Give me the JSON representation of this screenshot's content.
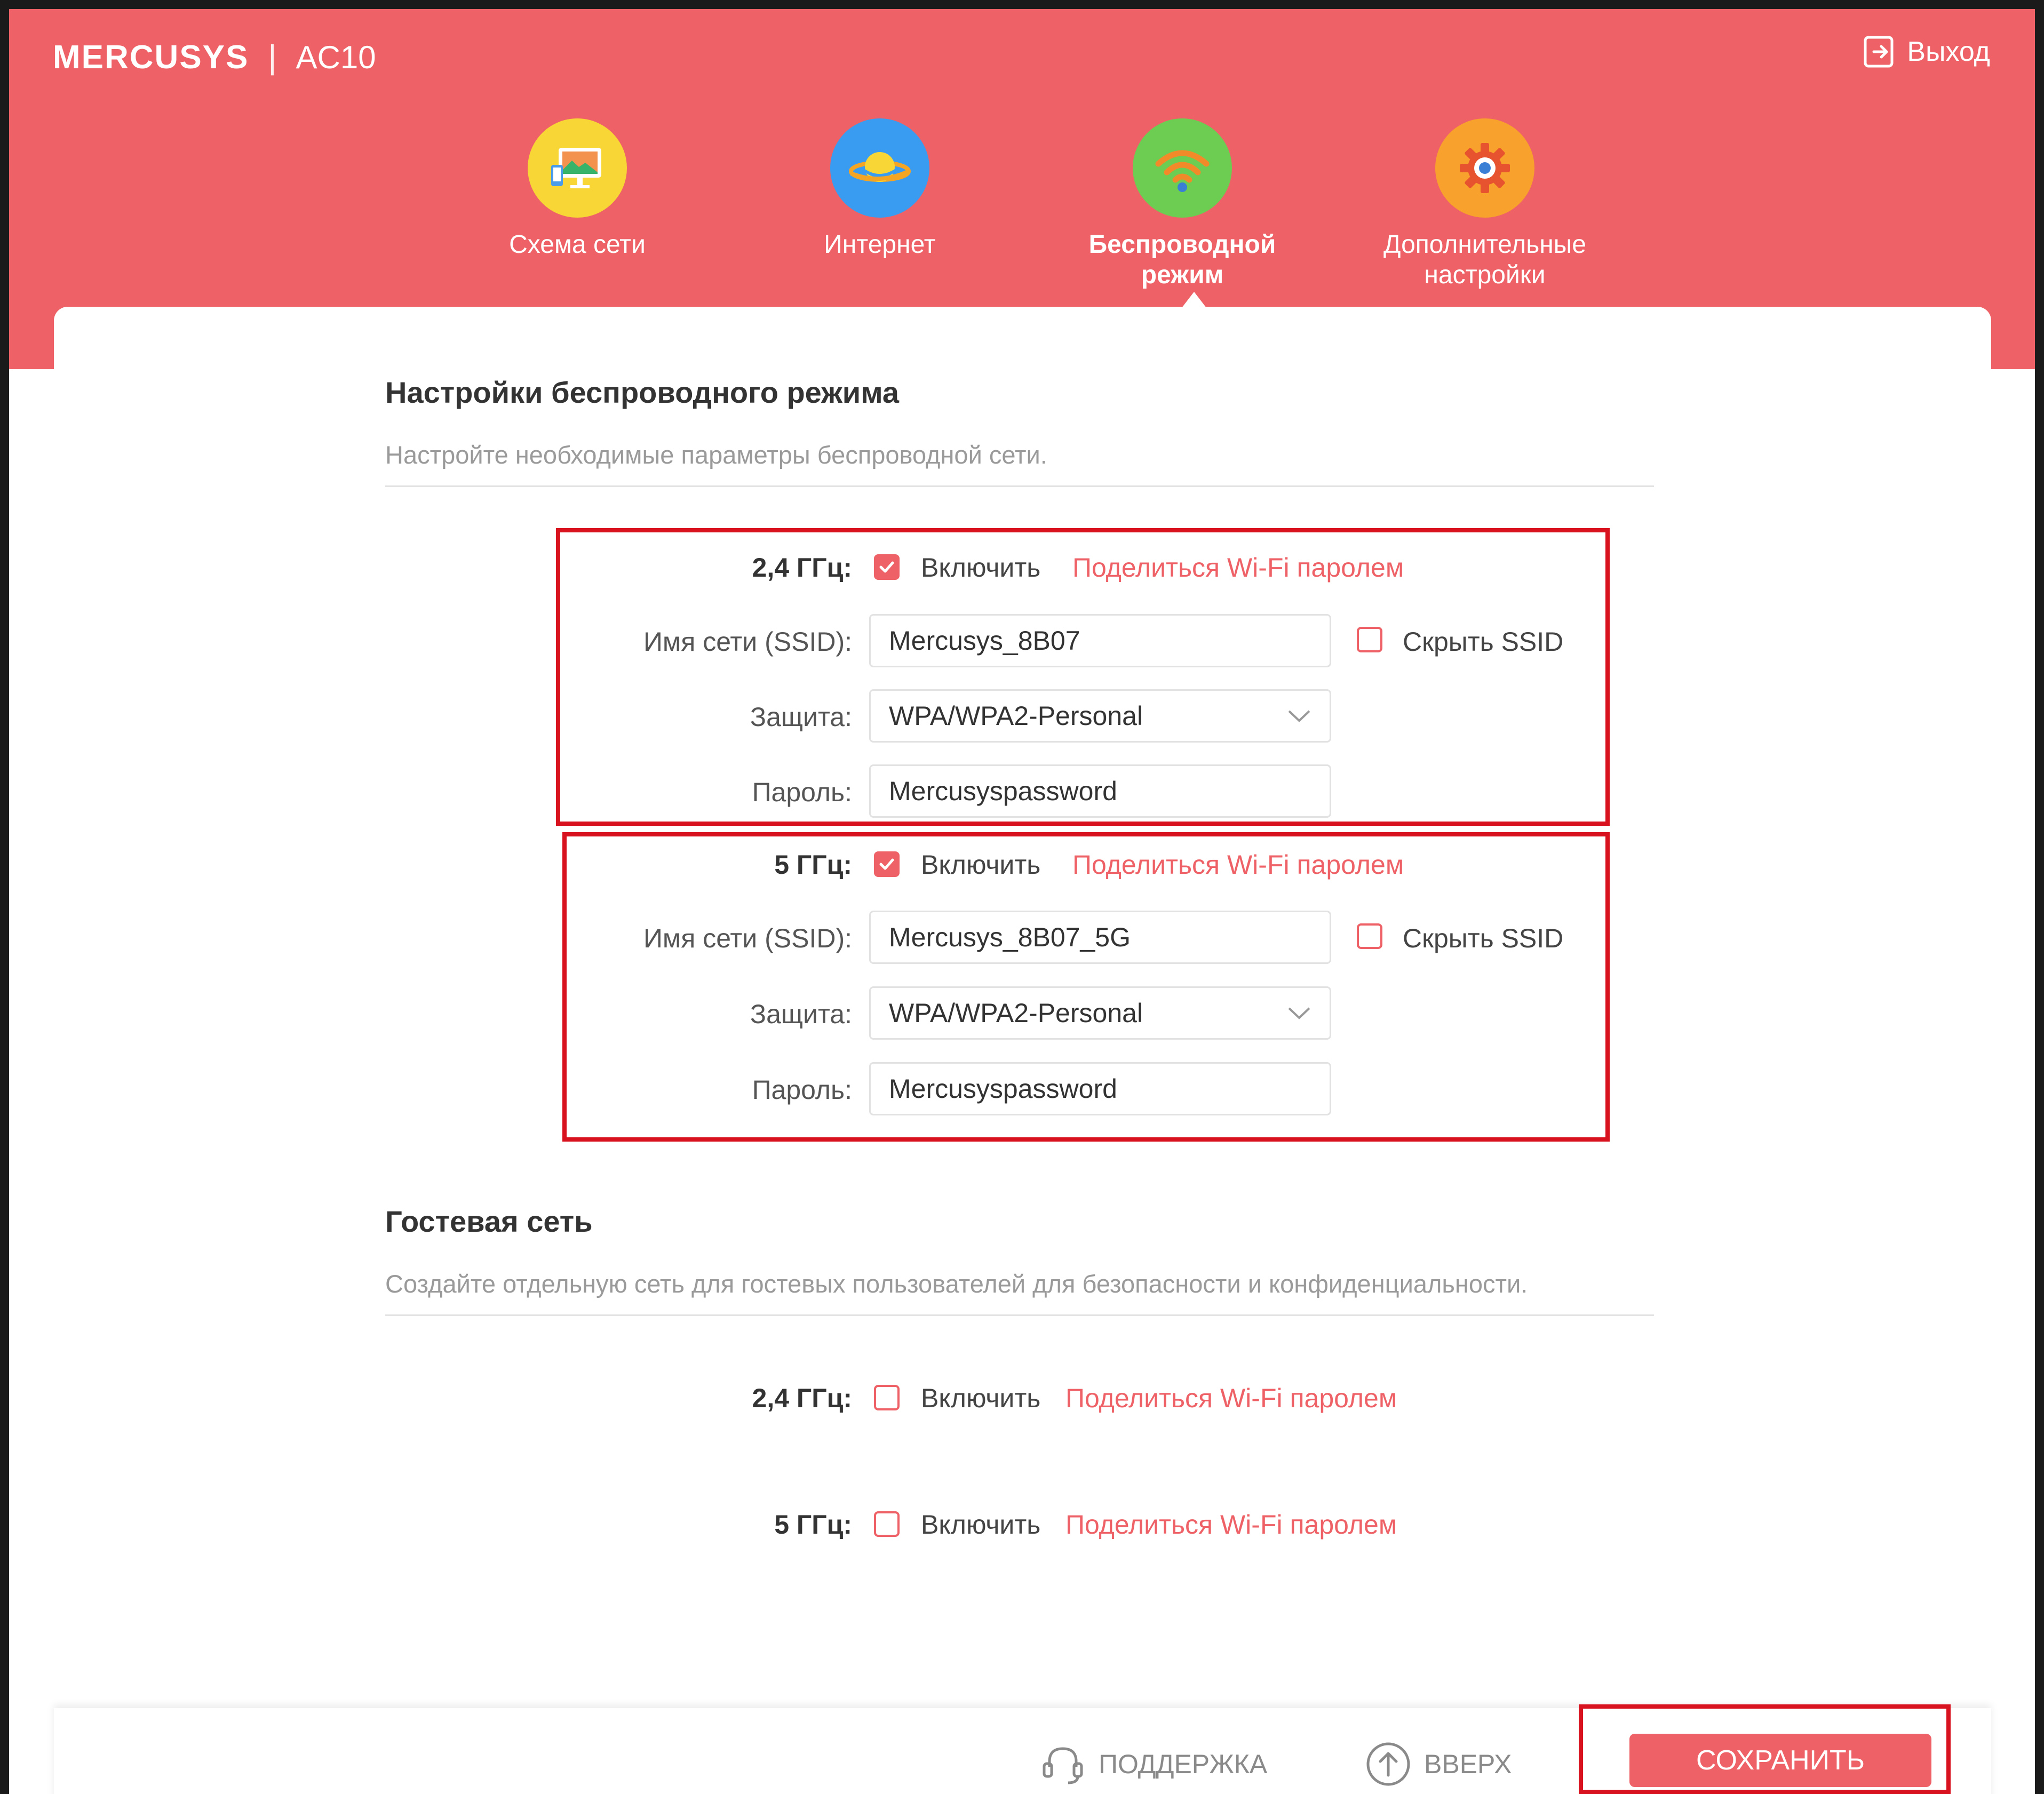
{
  "header": {
    "brand": "MERCUSYS",
    "model": "AC10",
    "logout_label": "Выход",
    "accent_color": "#ee6166"
  },
  "nav": [
    {
      "label": "Схема сети",
      "icon": "network-map-icon",
      "active": false
    },
    {
      "label": "Интернет",
      "icon": "internet-planet-icon",
      "active": false
    },
    {
      "label": "Беспроводной режим",
      "icon": "wifi-icon",
      "active": true
    },
    {
      "label": "Дополнительные настройки",
      "icon": "gear-icon",
      "active": false
    }
  ],
  "wireless": {
    "title": "Настройки беспроводного режима",
    "subtitle": "Настройте необходимые параметры беспроводной сети.",
    "band24": {
      "label": "2,4 ГГц:",
      "enable_label": "Включить",
      "enabled": true,
      "share_label": "Поделиться Wi-Fi паролем",
      "ssid_label": "Имя сети (SSID):",
      "ssid": "Mercusys_8B07",
      "hide_label": "Скрыть SSID",
      "hide_checked": false,
      "security_label": "Защита:",
      "security": "WPA/WPA2-Personal",
      "password_label": "Пароль:",
      "password": "Mercusyspassword"
    },
    "band5": {
      "label": "5 ГГц:",
      "enable_label": "Включить",
      "enabled": true,
      "share_label": "Поделиться Wi-Fi паролем",
      "ssid_label": "Имя сети (SSID):",
      "ssid": "Mercusys_8B07_5G",
      "hide_label": "Скрыть SSID",
      "hide_checked": false,
      "security_label": "Защита:",
      "security": "WPA/WPA2-Personal",
      "password_label": "Пароль:",
      "password": "Mercusyspassword"
    }
  },
  "guest": {
    "title": "Гостевая сеть",
    "subtitle": "Создайте отдельную сеть для гостевых пользователей для безопасности и конфиденциальности.",
    "band24": {
      "label": "2,4 ГГц:",
      "enable_label": "Включить",
      "enabled": false,
      "share_label": "Поделиться Wi-Fi паролем"
    },
    "band5": {
      "label": "5 ГГц:",
      "enable_label": "Включить",
      "enabled": false,
      "share_label": "Поделиться Wi-Fi паролем"
    }
  },
  "footer": {
    "support_label": "ПОДДЕРЖКА",
    "top_label": "ВВЕРХ",
    "save_label": "СОХРАНИТЬ"
  }
}
